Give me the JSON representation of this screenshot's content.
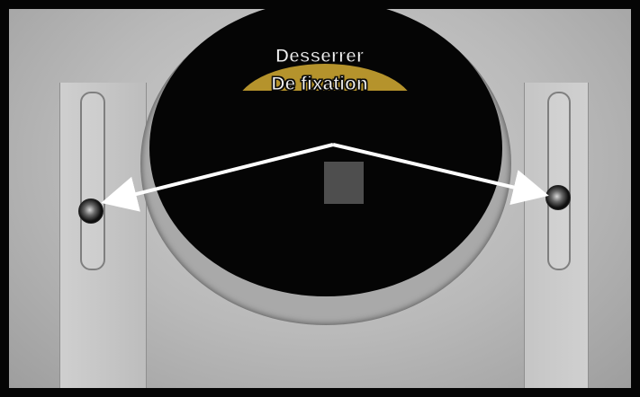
{
  "annotation": {
    "line1": "Desserrer",
    "line2": "De fixation"
  },
  "colors": {
    "arrow": "#ffffff",
    "label_text": "#f3f3f3",
    "label_outline": "#111111",
    "metal": "#b8b8b8",
    "opening": "#050505",
    "accent": "#b5932c"
  },
  "icons": {
    "arrow_left": "arrow-left-icon",
    "arrow_right": "arrow-right-icon"
  }
}
